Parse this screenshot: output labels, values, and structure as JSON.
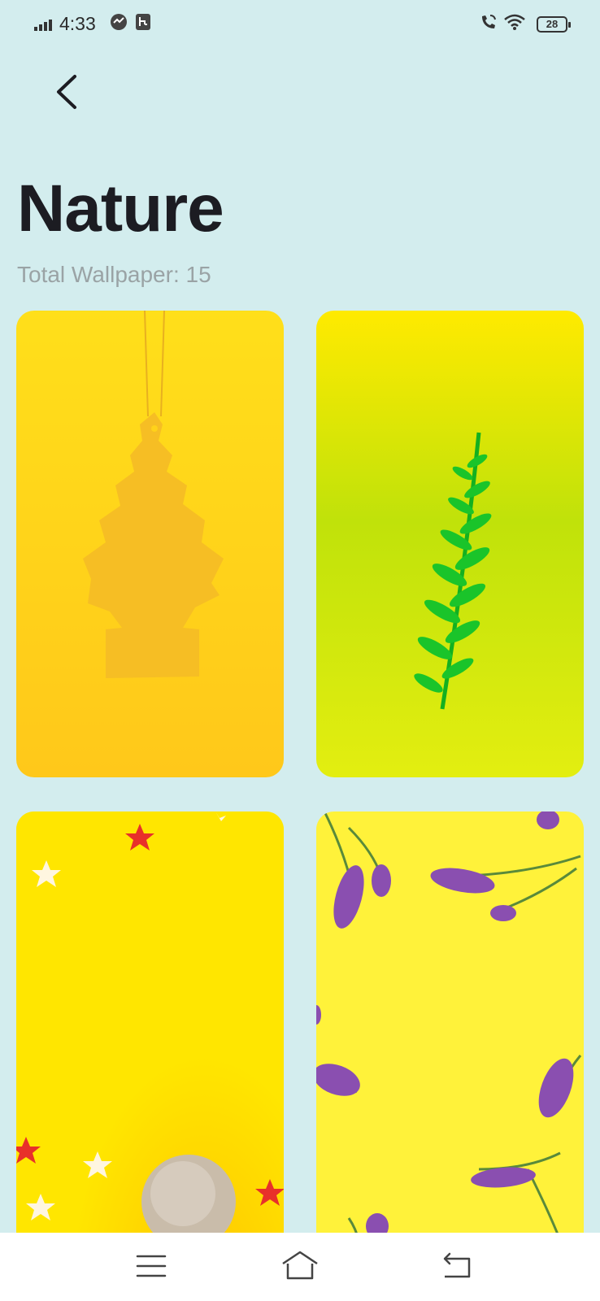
{
  "status_bar": {
    "time": "4:33",
    "battery_level": "28",
    "icons": [
      "signal-icon",
      "sync-icon",
      "usb-icon",
      "vowifi-call-icon",
      "wifi-icon",
      "battery-icon"
    ]
  },
  "header": {
    "back_icon": "chevron-left-icon",
    "title": "Nature",
    "total_label": "Total Wallpaper: 15"
  },
  "wallpapers": [
    {
      "subject": "yellow tree air freshener",
      "bg": "#ffd21a"
    },
    {
      "subject": "green fern leaf",
      "bg": "#c8e20a"
    },
    {
      "subject": "stars and glitter ball",
      "bg": "#ffe600"
    },
    {
      "subject": "purple flowers",
      "bg": "#fff23a"
    }
  ],
  "nav_bar": {
    "items": [
      "menu-icon",
      "home-icon",
      "back-icon"
    ]
  },
  "colors": {
    "background": "#d3edee",
    "title": "#1c1c22",
    "subtitle": "#9aa3a5"
  }
}
